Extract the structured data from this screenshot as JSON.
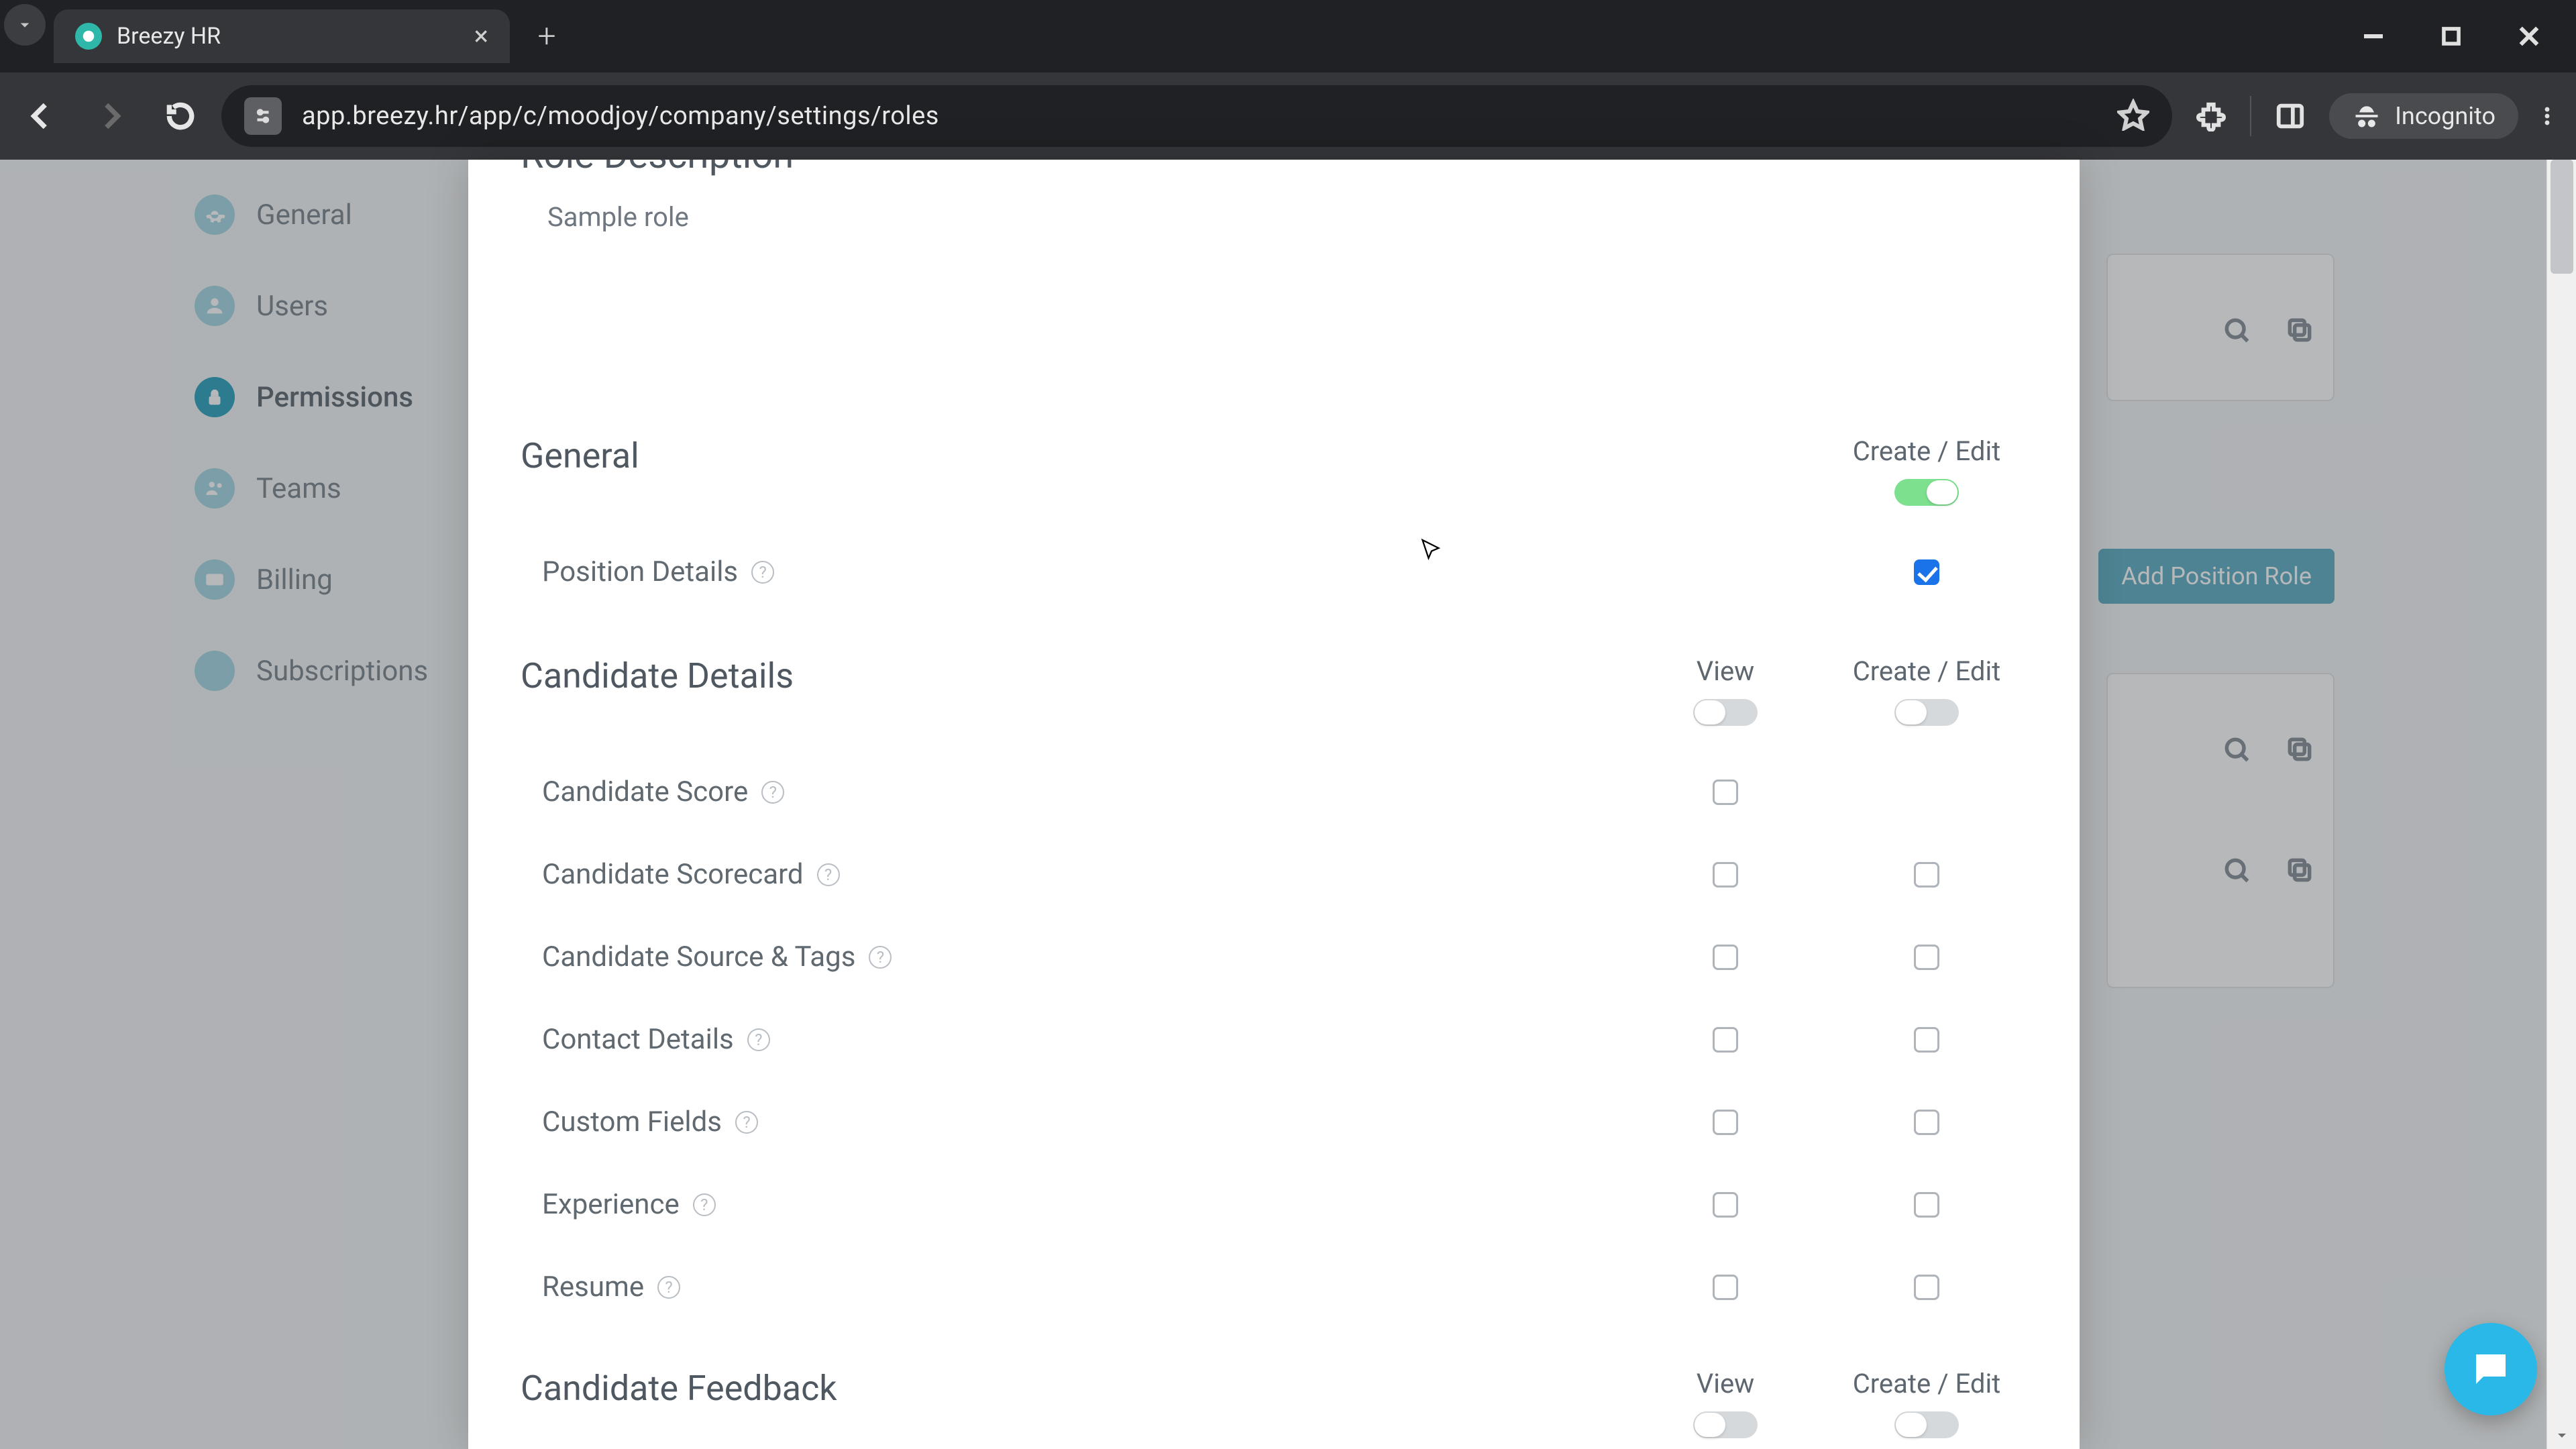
{
  "browser": {
    "tab_title": "Breezy HR",
    "url": "app.breezy.hr/app/c/moodjoy/company/settings/roles",
    "incognito_label": "Incognito"
  },
  "sidebar": {
    "items": [
      {
        "label": "General"
      },
      {
        "label": "Users"
      },
      {
        "label": "Permissions"
      },
      {
        "label": "Teams"
      },
      {
        "label": "Billing"
      },
      {
        "label": "Subscriptions"
      }
    ]
  },
  "background": {
    "add_position_role_label": "Add Position Role"
  },
  "modal": {
    "role_description_heading": "Role Description",
    "role_description_value": "Sample role",
    "columns": {
      "view": "View",
      "create_edit": "Create / Edit"
    },
    "sections": [
      {
        "title": "General",
        "has_view_col": false,
        "create_edit_toggle": "on",
        "rows": [
          {
            "name": "Position Details",
            "view": null,
            "create_edit": true
          }
        ]
      },
      {
        "title": "Candidate Details",
        "has_view_col": true,
        "view_toggle": "off",
        "create_edit_toggle": "off",
        "rows": [
          {
            "name": "Candidate Score",
            "view": false,
            "create_edit": null
          },
          {
            "name": "Candidate Scorecard",
            "view": false,
            "create_edit": false
          },
          {
            "name": "Candidate Source & Tags",
            "view": false,
            "create_edit": false
          },
          {
            "name": "Contact Details",
            "view": false,
            "create_edit": false
          },
          {
            "name": "Custom Fields",
            "view": false,
            "create_edit": false
          },
          {
            "name": "Experience",
            "view": false,
            "create_edit": false
          },
          {
            "name": "Resume",
            "view": false,
            "create_edit": false
          }
        ]
      },
      {
        "title": "Candidate Feedback",
        "has_view_col": true,
        "view_toggle": "off",
        "create_edit_toggle": "off",
        "rows": []
      }
    ]
  }
}
